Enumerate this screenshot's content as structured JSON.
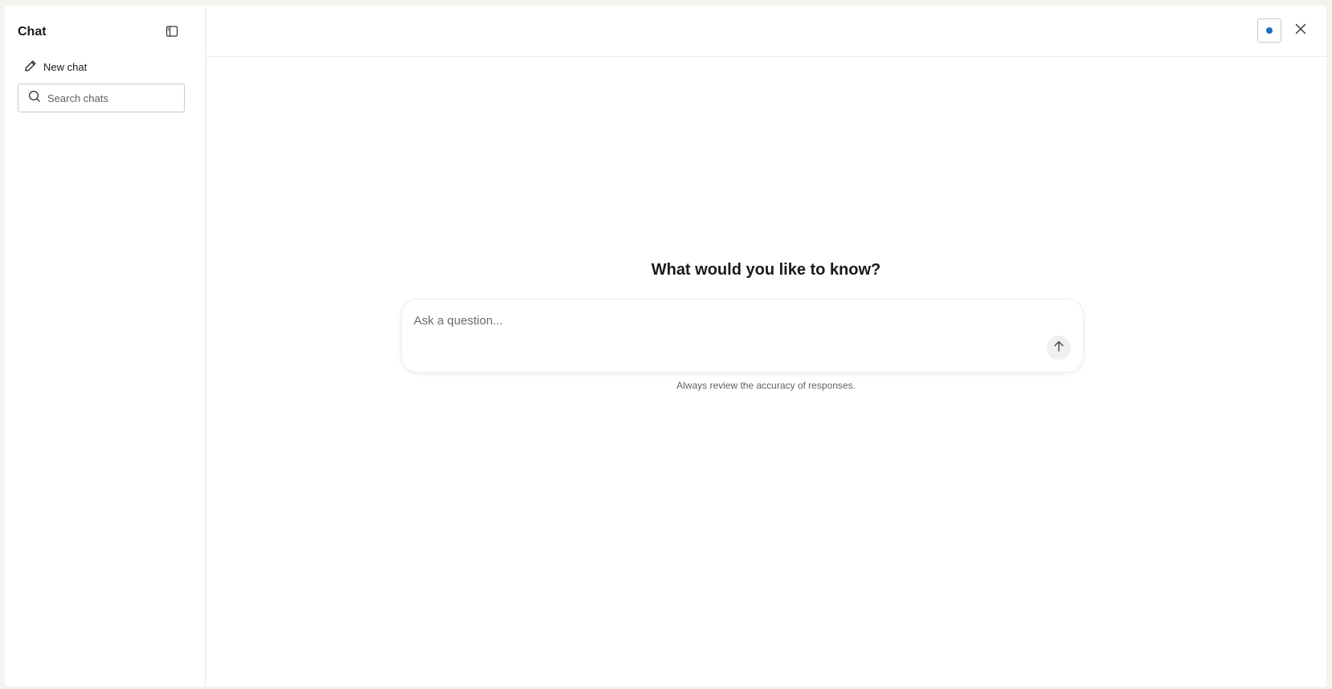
{
  "sidebar": {
    "title": "Chat",
    "collapse_icon": "sidebar-panel-icon",
    "new_chat": {
      "label": "New chat",
      "icon": "pencil-icon"
    },
    "search": {
      "placeholder": "Search chats",
      "value": "",
      "icon": "search-icon"
    }
  },
  "header": {
    "status_indicator_color": "#1d6ec4",
    "close_icon": "close-icon"
  },
  "main": {
    "heading": "What would you like to know?",
    "composer": {
      "placeholder": "Ask a question...",
      "value": "",
      "send_icon": "arrow-up-icon"
    },
    "disclaimer": "Always review the accuracy of responses."
  },
  "colors": {
    "background": "#f4f3ef",
    "surface": "#ffffff",
    "accent": "#1d6ec4",
    "border": "#c9c9c9"
  }
}
